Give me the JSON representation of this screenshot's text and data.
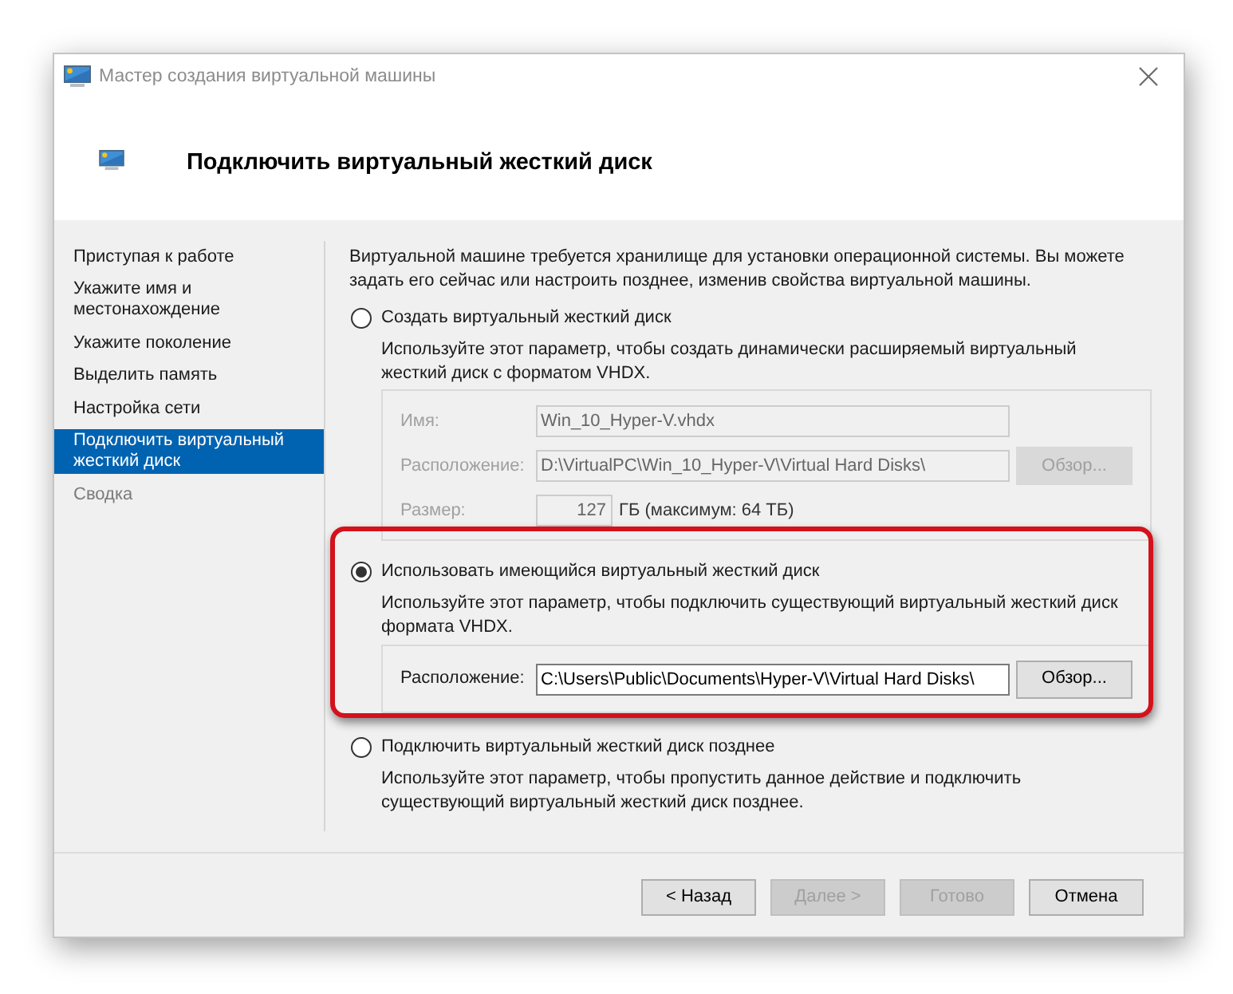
{
  "window": {
    "title": "Мастер создания виртуальной машины"
  },
  "header": {
    "title": "Подключить виртуальный жесткий диск"
  },
  "steps": [
    {
      "label": "Приступая к работе",
      "selected": false,
      "disabled": false
    },
    {
      "label": "Укажите имя и местонахождение",
      "selected": false,
      "disabled": false
    },
    {
      "label": "Укажите поколение",
      "selected": false,
      "disabled": false
    },
    {
      "label": "Выделить память",
      "selected": false,
      "disabled": false
    },
    {
      "label": "Настройка сети",
      "selected": false,
      "disabled": false
    },
    {
      "label": "Подключить виртуальный жесткий диск",
      "selected": true,
      "disabled": false
    },
    {
      "label": "Сводка",
      "selected": false,
      "disabled": true
    }
  ],
  "intro": "Виртуальной машине требуется хранилище для установки операционной системы. Вы можете задать его сейчас или настроить позднее, изменив свойства виртуальной машины.",
  "options": [
    {
      "label": "Создать виртуальный жесткий диск",
      "selected": false,
      "highlighted": false,
      "description": "Используйте этот параметр, чтобы создать динамически расширяемый виртуальный жесткий диск с форматом VHDX.",
      "fields": [
        {
          "kind": "text",
          "label": "Имя:",
          "value": "Win_10_Hyper-V.vhdx",
          "disabled": true
        },
        {
          "kind": "path",
          "label": "Расположение:",
          "value": "D:\\VirtualPC\\Win_10_Hyper-V\\Virtual Hard Disks\\",
          "button": "Обзор...",
          "disabled": true
        },
        {
          "kind": "size",
          "label": "Размер:",
          "value": "127",
          "unit": "ГБ (максимум: 64 ТБ)",
          "disabled": true
        }
      ]
    },
    {
      "label": "Использовать имеющийся виртуальный жесткий диск",
      "selected": true,
      "highlighted": true,
      "description": "Используйте этот параметр, чтобы подключить существующий виртуальный жесткий диск формата VHDX.",
      "fields": [
        {
          "kind": "path",
          "label": "Расположение:",
          "value": "C:\\Users\\Public\\Documents\\Hyper-V\\Virtual Hard Disks\\",
          "button": "Обзор...",
          "disabled": false
        }
      ]
    },
    {
      "label": "Подключить виртуальный жесткий диск позднее",
      "selected": false,
      "highlighted": false,
      "description": "Используйте этот параметр, чтобы пропустить данное действие и подключить существующий виртуальный жесткий диск позднее."
    }
  ],
  "buttons": [
    {
      "label": "< Назад",
      "disabled": false
    },
    {
      "label": "Далее >",
      "disabled": true
    },
    {
      "label": "Готово",
      "disabled": true
    },
    {
      "label": "Отмена",
      "disabled": false
    }
  ]
}
